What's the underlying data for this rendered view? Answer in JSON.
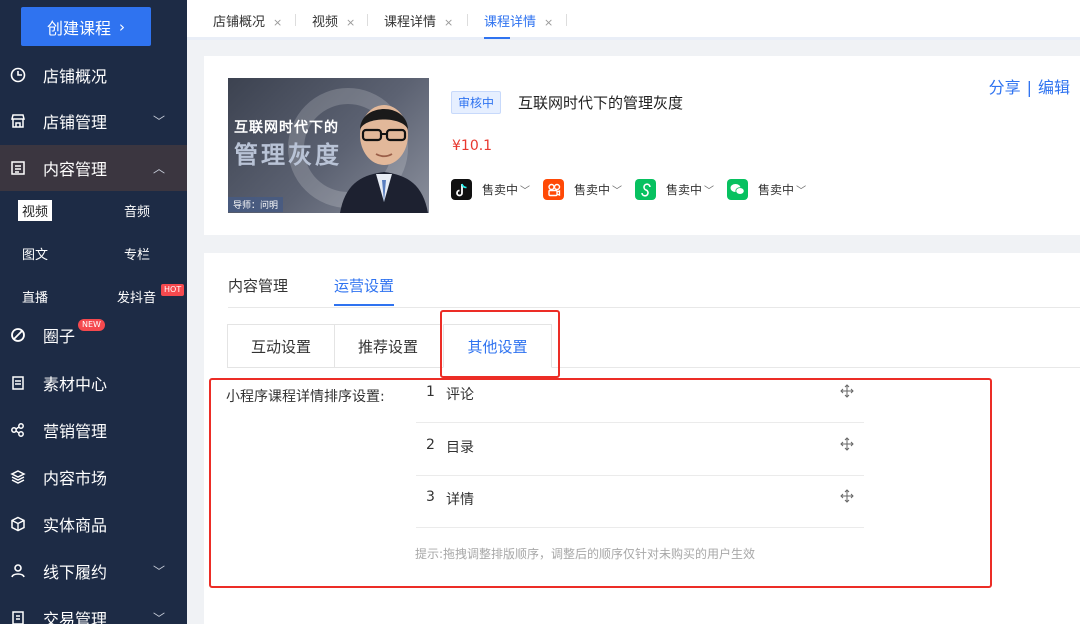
{
  "sidebar": {
    "create_button": "创建课程",
    "items": [
      {
        "label": "店铺概况",
        "icon": "clock-icon"
      },
      {
        "label": "店铺管理",
        "icon": "store-icon"
      },
      {
        "label": "内容管理",
        "icon": "content-icon"
      },
      {
        "label": "圈子",
        "icon": "circle-icon",
        "badge": "NEW"
      },
      {
        "label": "素材中心",
        "icon": "material-icon"
      },
      {
        "label": "营销管理",
        "icon": "marketing-icon"
      },
      {
        "label": "内容市场",
        "icon": "layers-icon"
      },
      {
        "label": "实体商品",
        "icon": "cube-icon"
      },
      {
        "label": "线下履约",
        "icon": "person-icon"
      },
      {
        "label": "交易管理",
        "icon": "trade-icon"
      }
    ],
    "sub_items": [
      "视频",
      "音频",
      "图文",
      "专栏",
      "直播",
      "发抖音"
    ],
    "hot_badge": "HOT"
  },
  "tabs": [
    "店铺概况",
    "视频",
    "课程详情",
    "课程详情"
  ],
  "course": {
    "status": "审核中",
    "title": "互联网时代下的管理灰度",
    "price": "¥10.1",
    "thumb_line1": "互联网时代下的",
    "thumb_line2": "管理灰度",
    "thumb_caption": "导师：问明",
    "channels": [
      {
        "name": "douyin",
        "status": "售卖中",
        "color": "#111111"
      },
      {
        "name": "kuaishou",
        "status": "售卖中",
        "color": "#ff4906"
      },
      {
        "name": "mini-program",
        "status": "售卖中",
        "color": "#07c160"
      },
      {
        "name": "wechat",
        "status": "售卖中",
        "color": "#07c160"
      }
    ],
    "share": "分享",
    "edit": "编辑"
  },
  "settings": {
    "main_tabs": [
      "内容管理",
      "运营设置"
    ],
    "sub_tabs": [
      "互动设置",
      "推荐设置",
      "其他设置"
    ],
    "sort_label": "小程序课程详情排序设置:",
    "sort_items": [
      {
        "num": "1",
        "label": "评论"
      },
      {
        "num": "2",
        "label": "目录"
      },
      {
        "num": "3",
        "label": "详情"
      }
    ],
    "hint": "提示:拖拽调整排版顺序，调整后的顺序仅针对未购买的用户生效"
  },
  "colors": {
    "accent": "#2f73f0",
    "sidebar_bg": "#1d2b45",
    "highlight": "#ec2d26",
    "price": "#e8382f"
  }
}
